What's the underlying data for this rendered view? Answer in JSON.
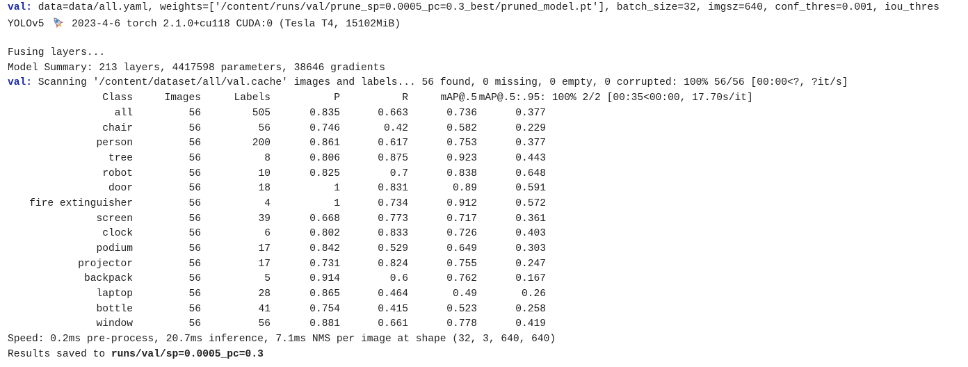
{
  "console": {
    "val_prefix": "val:",
    "val_args": " data=data/all.yaml, weights=['/content/runs/val/prune_sp=0.0005_pc=0.3_best/pruned_model.pt'], batch_size=32, imgsz=640, conf_thres=0.001, iou_thres",
    "yolo_name": "YOLOv5 ",
    "rocket_icon": "rocket-icon",
    "yolo_info": " 2023-4-6 torch 2.1.0+cu118 CUDA:0 (Tesla T4, 15102MiB)",
    "fusing": "Fusing layers...",
    "summary": "Model Summary: 213 layers, 4417598 parameters, 38646 gradients",
    "scan_prefix": "val:",
    "scan_text": " Scanning '/content/dataset/all/val.cache' images and labels... 56 found, 0 missing, 0 empty, 0 corrupted: 100% 56/56 [00:00<?, ?it/s]",
    "speed": "Speed: 0.2ms pre-process, 20.7ms inference, 7.1ms NMS per image at shape (32, 3, 640, 640)",
    "results_prefix": "Results saved to ",
    "results_path": "runs/val/sp=0.0005_pc=0.3"
  },
  "table": {
    "headers": {
      "class": "Class",
      "images": "Images",
      "labels": "Labels",
      "p": "P",
      "r": "R",
      "map50": "mAP@.5",
      "map5095": "mAP@.5:.95:",
      "progress": " 100% 2/2 [00:35<00:00, 17.70s/it]"
    },
    "rows": [
      {
        "class": "all",
        "images": "56",
        "labels": "505",
        "p": "0.835",
        "r": "0.663",
        "map50": "0.736",
        "map5095": "0.377"
      },
      {
        "class": "chair",
        "images": "56",
        "labels": "56",
        "p": "0.746",
        "r": "0.42",
        "map50": "0.582",
        "map5095": "0.229"
      },
      {
        "class": "person",
        "images": "56",
        "labels": "200",
        "p": "0.861",
        "r": "0.617",
        "map50": "0.753",
        "map5095": "0.377"
      },
      {
        "class": "tree",
        "images": "56",
        "labels": "8",
        "p": "0.806",
        "r": "0.875",
        "map50": "0.923",
        "map5095": "0.443"
      },
      {
        "class": "robot",
        "images": "56",
        "labels": "10",
        "p": "0.825",
        "r": "0.7",
        "map50": "0.838",
        "map5095": "0.648"
      },
      {
        "class": "door",
        "images": "56",
        "labels": "18",
        "p": "1",
        "r": "0.831",
        "map50": "0.89",
        "map5095": "0.591"
      },
      {
        "class": "fire extinguisher",
        "images": "56",
        "labels": "4",
        "p": "1",
        "r": "0.734",
        "map50": "0.912",
        "map5095": "0.572"
      },
      {
        "class": "screen",
        "images": "56",
        "labels": "39",
        "p": "0.668",
        "r": "0.773",
        "map50": "0.717",
        "map5095": "0.361"
      },
      {
        "class": "clock",
        "images": "56",
        "labels": "6",
        "p": "0.802",
        "r": "0.833",
        "map50": "0.726",
        "map5095": "0.403"
      },
      {
        "class": "podium",
        "images": "56",
        "labels": "17",
        "p": "0.842",
        "r": "0.529",
        "map50": "0.649",
        "map5095": "0.303"
      },
      {
        "class": "projector",
        "images": "56",
        "labels": "17",
        "p": "0.731",
        "r": "0.824",
        "map50": "0.755",
        "map5095": "0.247"
      },
      {
        "class": "backpack",
        "images": "56",
        "labels": "5",
        "p": "0.914",
        "r": "0.6",
        "map50": "0.762",
        "map5095": "0.167"
      },
      {
        "class": "laptop",
        "images": "56",
        "labels": "28",
        "p": "0.865",
        "r": "0.464",
        "map50": "0.49",
        "map5095": "0.26"
      },
      {
        "class": "bottle",
        "images": "56",
        "labels": "41",
        "p": "0.754",
        "r": "0.415",
        "map50": "0.523",
        "map5095": "0.258"
      },
      {
        "class": "window",
        "images": "56",
        "labels": "56",
        "p": "0.881",
        "r": "0.661",
        "map50": "0.778",
        "map5095": "0.419"
      }
    ]
  },
  "colors": {
    "background": "#ffffff",
    "text": "#212121",
    "prefix": "#1a2aa6"
  }
}
